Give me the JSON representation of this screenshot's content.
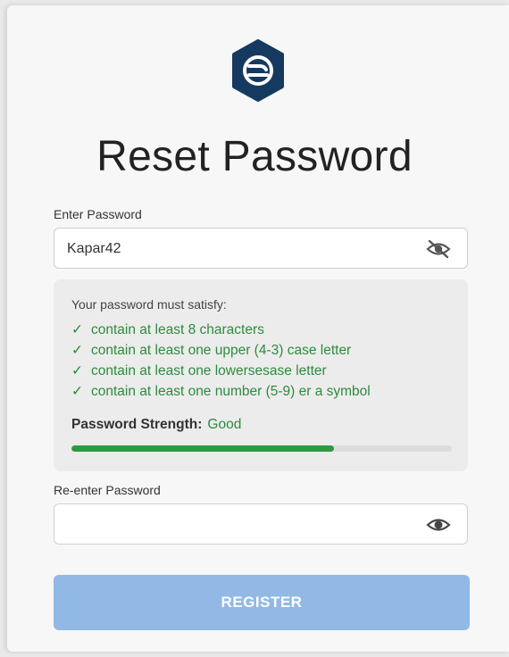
{
  "title": "Reset Password",
  "password": {
    "label": "Enter Password",
    "value": "Kapar42",
    "toggle_icon": "eye-slash-icon"
  },
  "requirements": {
    "title": "Your password must satisfy:",
    "items": [
      {
        "check": "✓",
        "text": "contain at least 8 characters"
      },
      {
        "check": "✓",
        "text": "contain at least one upper (4-3) case letter"
      },
      {
        "check": "✓",
        "text": "contain at least one lowersesase letter"
      },
      {
        "check": "✓",
        "text": "contain at least one number (5-9) er a symbol"
      }
    ],
    "strength_label": "Password Strength:",
    "strength_value": "Good",
    "strength_fraction": 0.69
  },
  "confirm": {
    "label": "Re-enter Password",
    "value": "",
    "toggle_icon": "eye-icon"
  },
  "register_label": "REGISTER",
  "colors": {
    "logo": "#163a5f",
    "success": "#2e8b3d",
    "strength_bar": "#2e9a3f",
    "button": "#92b9e6"
  }
}
